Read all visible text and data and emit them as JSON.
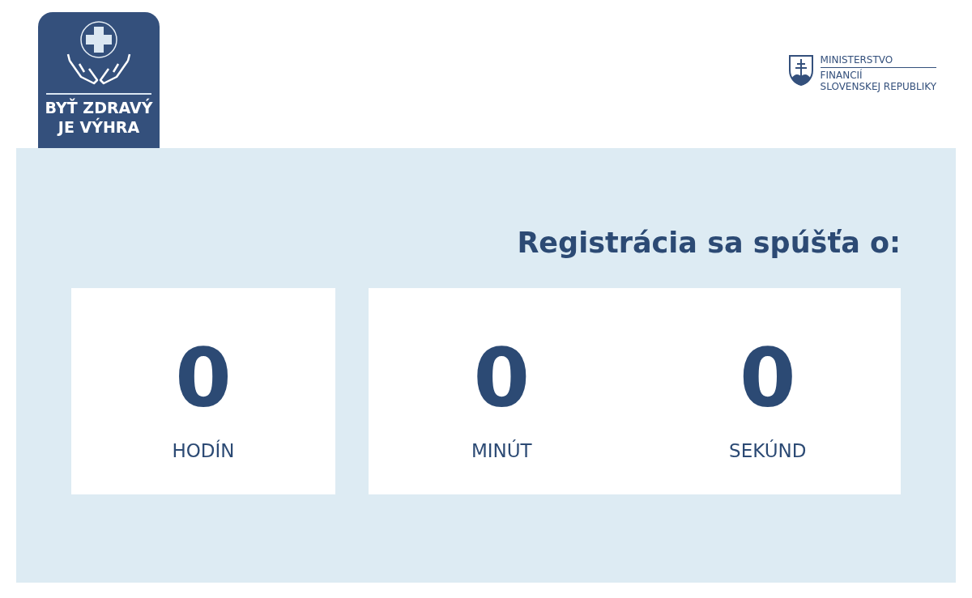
{
  "logo": {
    "lines": [
      "BYŤ ZDRAVÝ",
      "JE VÝHRA"
    ]
  },
  "ministry": {
    "title": "MINISTERSTVO",
    "lines": [
      "FINANCIÍ",
      "SLOVENSKEJ REPUBLIKY"
    ]
  },
  "heading": "Registrácia sa spúšťa o:",
  "cards": [
    {
      "units": [
        {
          "value": "0",
          "label": "HODÍN"
        }
      ]
    },
    {
      "units": [
        {
          "value": "0",
          "label": "MINÚT"
        },
        {
          "value": "0",
          "label": "SEKÚND"
        }
      ]
    }
  ]
}
